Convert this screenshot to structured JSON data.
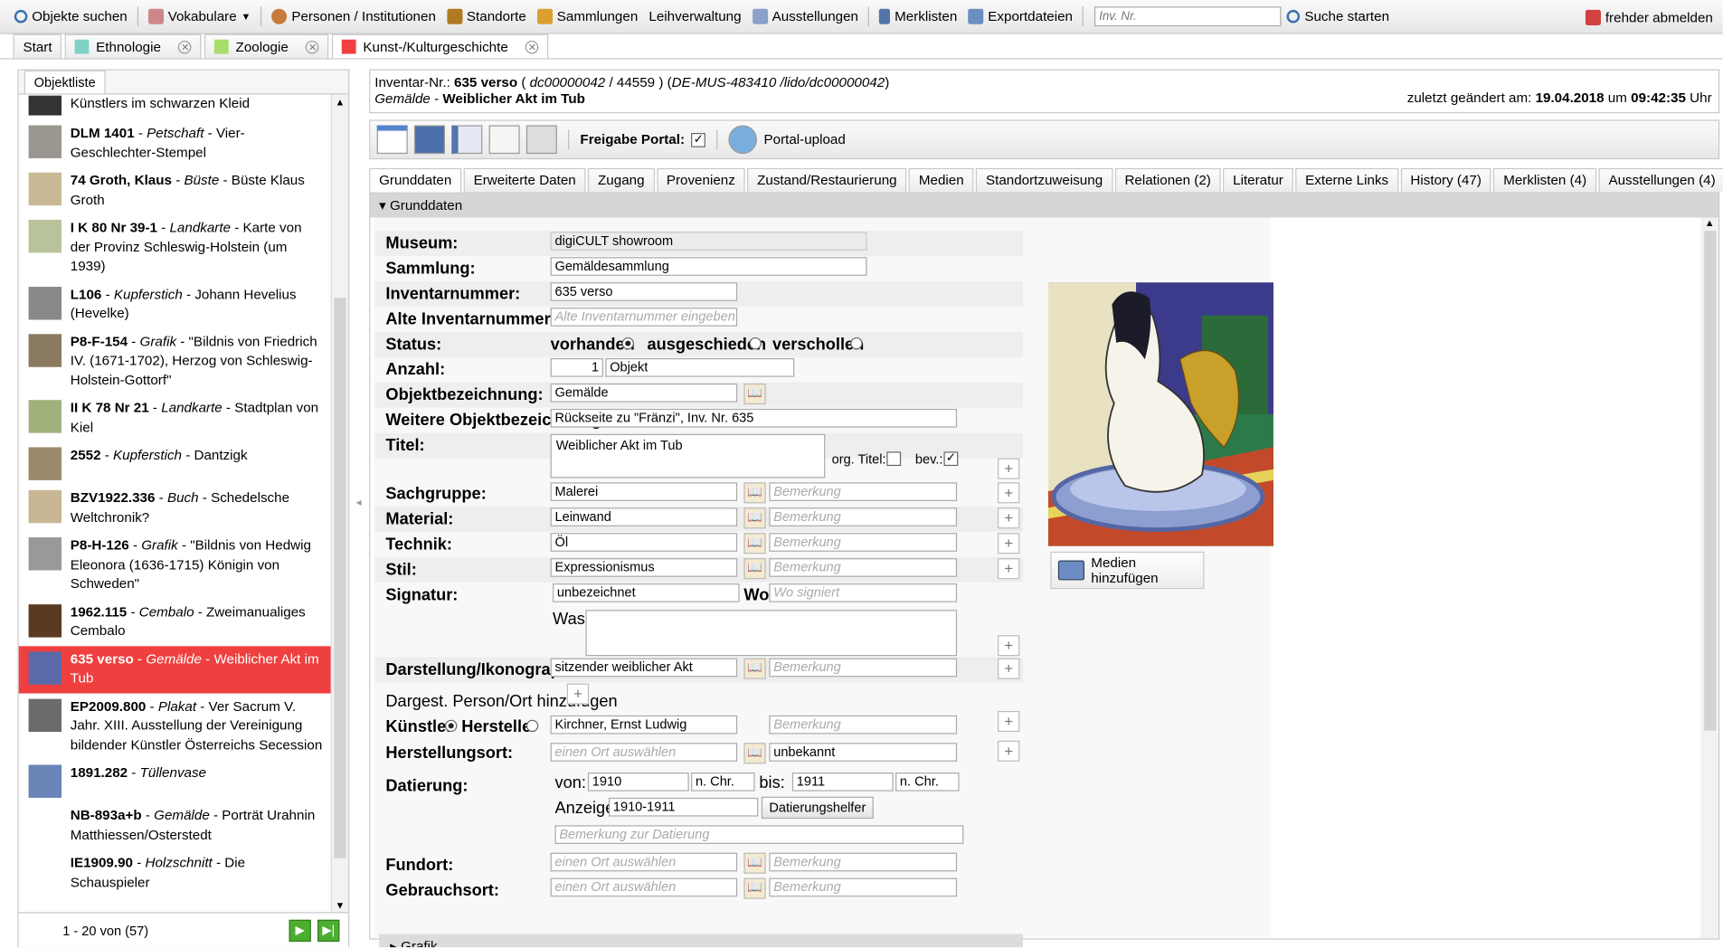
{
  "topbar": {
    "search": "Objekte suchen",
    "vocab": "Vokabulare",
    "persons": "Personen / Institutionen",
    "locations": "Standorte",
    "collections": "Sammlungen",
    "loans": "Leihverwaltung",
    "exhibitions": "Ausstellungen",
    "watchlists": "Merklisten",
    "exports": "Exportdateien",
    "inv_placeholder": "Inv. Nr.",
    "start_search": "Suche starten",
    "logout": "frehder abmelden"
  },
  "tabs": [
    {
      "label": "Start"
    },
    {
      "label": "Ethnologie",
      "color": "#7fd3c6"
    },
    {
      "label": "Zoologie",
      "color": "#a8de6b"
    },
    {
      "label": "Kunst-/Kulturgeschichte",
      "color": "#ef3f3f"
    }
  ],
  "objektliste": {
    "tab": "Objektliste",
    "items": [
      {
        "id": "",
        "type": "",
        "desc": "Künstlers im schwarzen Kleid",
        "thumb": "#333"
      },
      {
        "id": "DLM 1401",
        "type": "Petschaft",
        "desc": "Vier-Geschlechter-Stempel",
        "thumb": "#9a9790"
      },
      {
        "id": "74 Groth, Klaus",
        "type": "Büste",
        "desc": "Büste Klaus Groth",
        "thumb": "#c9b995"
      },
      {
        "id": "I K 80 Nr 39-1",
        "type": "Landkarte",
        "desc": "Karte von der Provinz Schleswig-Holstein (um 1939)",
        "thumb": "#b8c39a"
      },
      {
        "id": "L106",
        "type": "Kupferstich",
        "desc": "Johann Hevelius (Hevelke)",
        "thumb": "#888"
      },
      {
        "id": "P8-F-154",
        "type": "Grafik",
        "desc": "\"Bildnis von Friedrich IV. (1671-1702), Herzog von Schleswig-Holstein-Gottorf\"",
        "thumb": "#8a7a60"
      },
      {
        "id": "II K 78 Nr 21",
        "type": "Landkarte",
        "desc": "Stadtplan von Kiel",
        "thumb": "#9fb27c"
      },
      {
        "id": "2552",
        "type": "Kupferstich",
        "desc": "Dantzigk",
        "thumb": "#9b8a6a"
      },
      {
        "id": "BZV1922.336",
        "type": "Buch",
        "desc": "Schedelsche Weltchronik?",
        "thumb": "#c8b694"
      },
      {
        "id": "P8-H-126",
        "type": "Grafik",
        "desc": "\"Bildnis von Hedwig Eleonora (1636-1715) Königin von Schweden\"",
        "thumb": "#999"
      },
      {
        "id": "1962.115",
        "type": "Cembalo",
        "desc": "Zweimanualiges Cembalo",
        "thumb": "#5a3a22"
      },
      {
        "id": "635 verso",
        "type": "Gemälde",
        "desc": "Weiblicher Akt im Tub",
        "thumb": "#5b6aa8"
      },
      {
        "id": "EP2009.800",
        "type": "Plakat",
        "desc": "Ver Sacrum V. Jahr. XIII. Ausstellung der Vereinigung bildender Künstler Österreichs Secession",
        "thumb": "#6b6b6b"
      },
      {
        "id": "1891.282",
        "type": "Tüllenvase",
        "desc": "",
        "thumb": "#6a84b8"
      },
      {
        "id": "NB-893a+b",
        "type": "Gemälde",
        "desc": "Porträt Urahnin Matthiessen/Osterstedt",
        "thumb": "#fff"
      },
      {
        "id": "IE1909.90",
        "type": "Holzschnitt",
        "desc": "Die Schauspieler",
        "thumb": "#fff"
      }
    ],
    "pager": "1 - 20 von (57)"
  },
  "header": {
    "inv_label": "Inventar-Nr.:",
    "inv": "635 verso",
    "id1": "dc00000042",
    "id2": "44559",
    "lido": "DE-MUS-483410 /lido/dc00000042",
    "type": "Gemälde",
    "title": "Weiblicher Akt im Tub",
    "changed_label": "zuletzt geändert am:",
    "date": "19.04.2018",
    "um": "um",
    "time": "09:42:35",
    "uhr": "Uhr"
  },
  "toolbar": {
    "freigabe": "Freigabe Portal:",
    "upload": "Portal-upload"
  },
  "subtabs": [
    "Grunddaten",
    "Erweiterte Daten",
    "Zugang",
    "Provenienz",
    "Zustand/Restaurierung",
    "Medien",
    "Standortzuweisung",
    "Relationen (2)",
    "Literatur",
    "Externe Links",
    "History (47)",
    "Merklisten (4)",
    "Ausstellungen (4)"
  ],
  "form": {
    "section": "Grunddaten",
    "museum_l": "Museum:",
    "museum": "digiCULT showroom",
    "sammlung_l": "Sammlung:",
    "sammlung": "Gemäldesammlung",
    "inv_l": "Inventarnummer:",
    "inv": "635 verso",
    "alt_l": "Alte Inventarnummer:",
    "alt_ph": "Alte Inventarnummer eingeben",
    "status_l": "Status:",
    "st1": "vorhanden",
    "st2": "ausgeschieden",
    "st3": "verschollen",
    "anzahl_l": "Anzahl:",
    "anzahl": "1",
    "anzahl_unit": "Objekt",
    "objbez_l": "Objektbezeichnung:",
    "objbez": "Gemälde",
    "weitere_l": "Weitere Objektbezeichnung:",
    "weitere": "Rückseite zu \"Fränzi\", Inv. Nr. 635",
    "titel_l": "Titel:",
    "titel": "Weiblicher Akt im Tub",
    "org": "org. Titel:",
    "bev": "bev.:",
    "sach_l": "Sachgruppe:",
    "sach": "Malerei",
    "mat_l": "Material:",
    "mat": "Leinwand",
    "tech_l": "Technik:",
    "tech": "Öl",
    "stil_l": "Stil:",
    "stil": "Expressionismus",
    "bem": "Bemerkung",
    "sig_l": "Signatur:",
    "sig": "unbezeichnet",
    "wo": "Wo:",
    "wo_ph": "Wo signiert",
    "was": "Was:",
    "dar_l": "Darstellung/Ikonographie:",
    "dar": "sitzender weiblicher Akt",
    "dargest": "Dargest. Person/Ort hinzufügen",
    "kuenstler": "Künstler",
    "hersteller": "Hersteller",
    "kuenstler_v": "Kirchner, Ernst Ludwig",
    "hort_l": "Herstellungsort:",
    "ort_ph": "einen Ort auswählen",
    "hort_bem": "unbekannt",
    "dat_l": "Datierung:",
    "von": "von:",
    "von_v": "1910",
    "chr": "n. Chr.",
    "bis": "bis:",
    "bis_v": "1911",
    "anz": "Anzeige:",
    "anz_v": "1910-1911",
    "helfer": "Datierungshelfer",
    "dat_bem": "Bemerkung zur Datierung",
    "fund_l": "Fundort:",
    "gebr_l": "Gebrauchsort:",
    "media": "Medien hinzufügen",
    "grafik": "Grafik"
  }
}
